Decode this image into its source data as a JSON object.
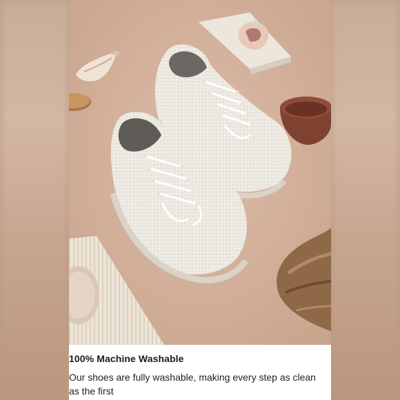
{
  "caption": {
    "title": "100% Machine Washable",
    "body": "Our shoes are fully washable, making every step as clean as the first"
  },
  "photo": {
    "subject": "pair-of-white-knit-sneakers",
    "props": [
      "seashell",
      "stone-tile-with-crystal",
      "terracotta-bowl",
      "wood-disc",
      "ribbed-paper-sheet",
      "felt-coaster",
      "driftwood"
    ]
  },
  "colors": {
    "backdrop": "#d7b6a2",
    "shoe": "#f3f0ea",
    "bowl": "#8a4a36",
    "driftwood": "#9a7352"
  }
}
